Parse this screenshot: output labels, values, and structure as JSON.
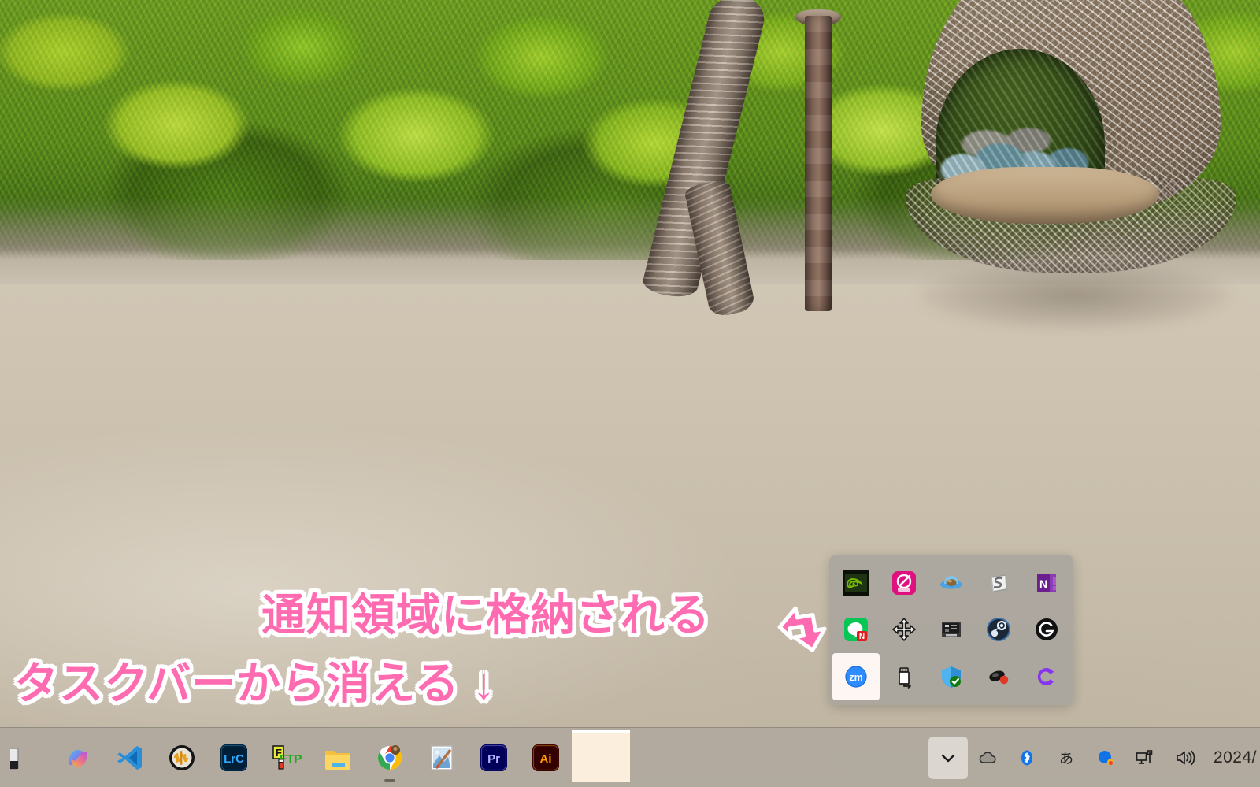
{
  "wallpaper": {
    "description": "tropical-beach-with-wicker-hanging-chair",
    "sand_color": "#cfc5b4",
    "foliage_color": "#7cab1f"
  },
  "annotations": {
    "accent_color": "#ff6bb0",
    "outline_color": "#ffffff",
    "tray_note": "通知領域に格納される",
    "taskbar_note": "タスクバーから消える ↓",
    "arrow_name": "diagonal-arrow-down-right"
  },
  "tray_flyout": {
    "background_color": "#aaa59d",
    "columns": 5,
    "rows": 3,
    "selected_index": 10,
    "items": [
      {
        "name": "nvidia-settings-icon",
        "label": "NVIDIA",
        "selected": false
      },
      {
        "name": "luminar-icon",
        "label": "Luminar",
        "selected": false
      },
      {
        "name": "blue-hat-app-icon",
        "label": "BlueHat",
        "selected": false
      },
      {
        "name": "s-scroll-app-icon",
        "label": "S",
        "selected": false
      },
      {
        "name": "onenote-icon",
        "label": "OneNote",
        "selected": false
      },
      {
        "name": "line-icon",
        "label": "LINE",
        "selected": false
      },
      {
        "name": "move-cursor-icon",
        "label": "Move",
        "selected": false
      },
      {
        "name": "device-manager-icon",
        "label": "Device",
        "selected": false
      },
      {
        "name": "steam-icon",
        "label": "Steam",
        "selected": false
      },
      {
        "name": "logitech-g-hub-icon",
        "label": "Logitech G HUB",
        "selected": false
      },
      {
        "name": "zoom-icon",
        "label": "Zoom",
        "selected": true
      },
      {
        "name": "safely-remove-usb-icon",
        "label": "ハードウェアの安全な取り外し",
        "selected": false
      },
      {
        "name": "windows-security-icon",
        "label": "Windows セキュリティ",
        "selected": false
      },
      {
        "name": "rec-app-icon",
        "label": "Recorder",
        "selected": false
      },
      {
        "name": "c-app-icon",
        "label": "C",
        "selected": false
      }
    ]
  },
  "taskbar": {
    "background_color": "#b0a99e",
    "apps": [
      {
        "name": "taskbar-app-cut",
        "label": "",
        "running": false
      },
      {
        "name": "taskbar-app-copilot",
        "label": "Copilot",
        "running": false
      },
      {
        "name": "taskbar-app-vscode",
        "label": "Visual Studio Code",
        "running": false
      },
      {
        "name": "taskbar-app-audio",
        "label": "Audio",
        "running": false
      },
      {
        "name": "taskbar-app-lightroom",
        "label": "Lightroom Classic",
        "running": false
      },
      {
        "name": "taskbar-app-ffftp",
        "label": "FFFTP",
        "running": false
      },
      {
        "name": "taskbar-app-explorer",
        "label": "エクスプローラー",
        "running": false
      },
      {
        "name": "taskbar-app-chrome",
        "label": "Google Chrome",
        "running": true
      },
      {
        "name": "taskbar-app-paint",
        "label": "ペイント",
        "running": false
      },
      {
        "name": "taskbar-app-premiere",
        "label": "Premiere Pro",
        "running": false
      },
      {
        "name": "taskbar-app-illustrator",
        "label": "Illustrator",
        "running": false
      }
    ],
    "empty_slot_label": "",
    "tray": [
      {
        "name": "show-hidden-icons-chevron",
        "label": "隠れているインジケーターを表示",
        "glyph": "chevron-down",
        "active": true
      },
      {
        "name": "onedrive-icon",
        "label": "OneDrive",
        "glyph": "cloud",
        "active": false
      },
      {
        "name": "bluetooth-icon",
        "label": "Bluetooth",
        "glyph": "bluetooth",
        "active": false
      },
      {
        "name": "ime-mode-icon",
        "label": "あ",
        "glyph": "ime-a",
        "active": false
      },
      {
        "name": "ime-tool-icon",
        "label": "IME ツール",
        "glyph": "ime-circle",
        "active": false
      },
      {
        "name": "network-icon",
        "label": "ネットワーク",
        "glyph": "monitor",
        "active": false
      },
      {
        "name": "volume-icon",
        "label": "音量",
        "glyph": "speaker",
        "active": false
      }
    ],
    "clock": "2024/"
  }
}
